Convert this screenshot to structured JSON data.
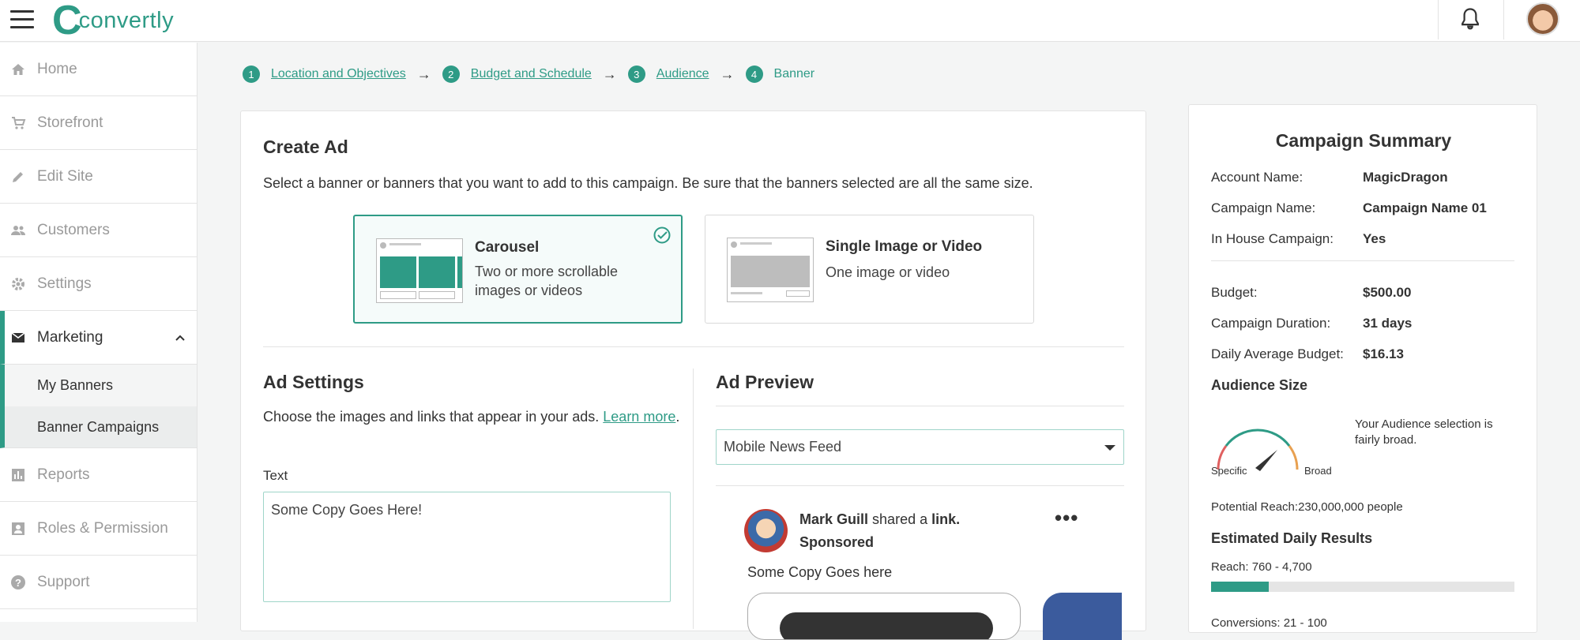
{
  "brand": {
    "name": "convertly",
    "accent": "#2e9b86"
  },
  "sidebar": {
    "items": [
      {
        "label": "Home",
        "icon": "home-icon"
      },
      {
        "label": "Storefront",
        "icon": "cart-icon"
      },
      {
        "label": "Edit Site",
        "icon": "pencil-icon"
      },
      {
        "label": "Customers",
        "icon": "people-icon"
      },
      {
        "label": "Settings",
        "icon": "gear-icon"
      },
      {
        "label": "Marketing",
        "icon": "mail-icon",
        "expanded": true
      },
      {
        "label": "Reports",
        "icon": "bar-chart-icon"
      },
      {
        "label": "Roles & Permission",
        "icon": "badge-icon"
      },
      {
        "label": "Support",
        "icon": "help-icon"
      }
    ],
    "sub_items": [
      {
        "label": "My Banners"
      },
      {
        "label": "Banner Campaigns",
        "selected": true
      }
    ]
  },
  "breadcrumb": {
    "steps": [
      {
        "num": "1",
        "label": "Location and Objectives"
      },
      {
        "num": "2",
        "label": "Budget and Schedule"
      },
      {
        "num": "3",
        "label": "Audience"
      },
      {
        "num": "4",
        "label": "Banner"
      }
    ]
  },
  "create_ad": {
    "title": "Create Ad",
    "description": "Select a banner or banners that you want to add to this campaign. Be sure that the banners selected are all the same size.",
    "options": [
      {
        "title": "Carousel",
        "desc": "Two or more scrollable images or videos",
        "selected": true
      },
      {
        "title": "Single Image or Video",
        "desc": "One image or video",
        "selected": false
      }
    ]
  },
  "ad_settings": {
    "title": "Ad Settings",
    "description": "Choose the images and links that appear in your ads.",
    "learn_more": "Learn more",
    "period": ".",
    "text_label": "Text",
    "text_value": "Some Copy Goes Here!"
  },
  "ad_preview": {
    "title": "Ad Preview",
    "placement": "Mobile News Feed",
    "post": {
      "author": "Mark Guill",
      "shared": "shared a",
      "link_word": "link.",
      "sponsored": "Sponsored",
      "copy": "Some Copy Goes here",
      "more": "•••"
    }
  },
  "summary": {
    "title": "Campaign Summary",
    "rows_top": [
      {
        "k": "Account Name:",
        "v": "MagicDragon"
      },
      {
        "k": "Campaign Name:",
        "v": "Campaign Name 01"
      },
      {
        "k": "In House Campaign:",
        "v": "Yes"
      }
    ],
    "rows_mid": [
      {
        "k": "Budget:",
        "v": "$500.00"
      },
      {
        "k": "Campaign Duration:",
        "v": "31 days"
      },
      {
        "k": "Daily Average Budget:",
        "v": "$16.13"
      }
    ],
    "audience_size": "Audience Size",
    "gauge_specific": "Specific",
    "gauge_broad": "Broad",
    "audience_text": "Your Audience selection is fairly broad.",
    "potential_reach": "Potential Reach:230,000,000 people",
    "estimated": "Estimated Daily Results",
    "reach": "Reach: 760 - 4,700",
    "reach_fill_fraction": 0.19,
    "conversions": "Conversions: 21 - 100"
  }
}
